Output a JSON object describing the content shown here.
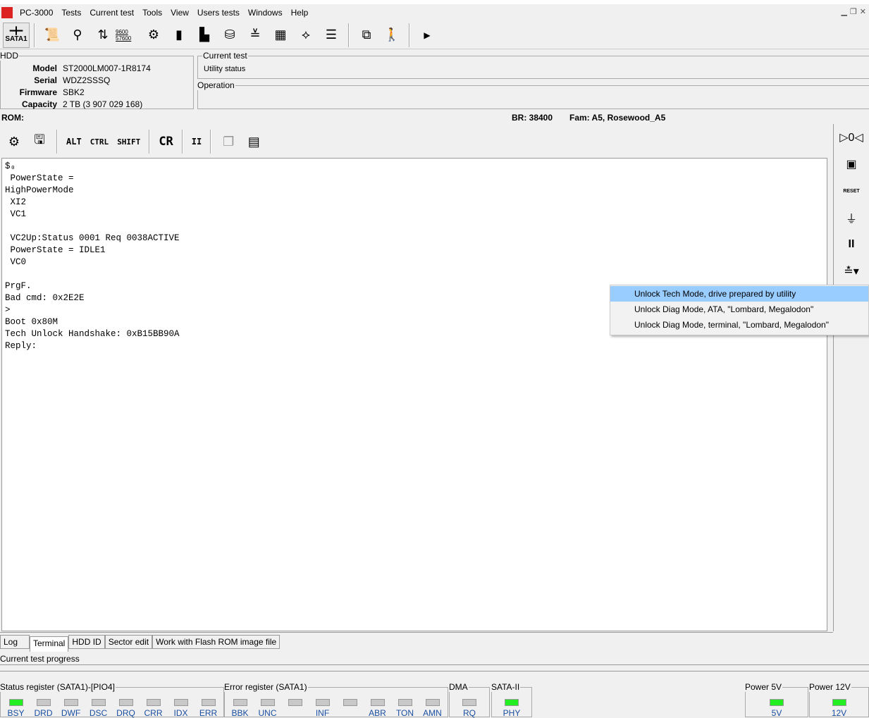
{
  "app": {
    "title": "PC-3000",
    "logo": "PC"
  },
  "menu": [
    "Tests",
    "Current test",
    "Tools",
    "View",
    "Users tests",
    "Windows",
    "Help"
  ],
  "toolbar": {
    "port_label": "SATA1",
    "icons": [
      "info-scroll-icon",
      "bulb-icon",
      "transfer-icon",
      "baud-rate-icon",
      "settings-disk-icon",
      "chip-icon",
      "board-icon",
      "disk-check-icon",
      "layers-icon",
      "grid-icon",
      "flowchart-icon",
      "list-icon",
      "windows-icon",
      "exit-icon",
      "more-icon"
    ],
    "baud_text": "9600 57600"
  },
  "hdd": {
    "legend": "HDD",
    "fields": [
      {
        "k": "Model",
        "v": "ST2000LM007-1R8174"
      },
      {
        "k": "Serial",
        "v": "WDZ2SSSQ"
      },
      {
        "k": "Firmware",
        "v": "SBK2"
      },
      {
        "k": "Capacity",
        "v": "2 TB (3 907 029 168)"
      }
    ]
  },
  "current_test": {
    "legend": "Current test",
    "status": "Utility status"
  },
  "operation": {
    "legend": "Operation"
  },
  "rom": {
    "label": "ROM:",
    "br": "BR: 38400",
    "fam": "Fam: A5, Rosewood_A5"
  },
  "terminal_toolbar": {
    "alt": "ALT",
    "ctrl": "CTRL",
    "shift": "SHIFT",
    "cr": "CR",
    "pause": "II"
  },
  "terminal_text": "$₀\n PowerState =\nHighPowerMode\n XI2\n VC1\n\n VC2Up:Status 0001 Req 0038ACTIVE\n PowerState = IDLE1\n VC0\n\nPrgF.\nBad cmd: 0x2E2E\n>\nBoot 0x80M\nTech Unlock Handshake: 0xB15BB90A\nReply:",
  "right_panel": {
    "pause": "II",
    "reset": "RESET"
  },
  "context_menu": [
    "Unlock Tech Mode, drive prepared by utility",
    "Unlock Diag Mode, ATA, \"Lombard, Megalodon\"",
    "Unlock Diag Mode, terminal, \"Lombard, Megalodon\""
  ],
  "tabs": [
    "Log",
    "Terminal",
    "HDD ID",
    "Sector edit",
    "Work with Flash ROM image file"
  ],
  "progress": {
    "label": "Current test progress",
    "value": 0
  },
  "status_register": {
    "legend": "Status register (SATA1)-[PIO4]",
    "bits": [
      {
        "n": "BSY",
        "on": true
      },
      {
        "n": "DRD",
        "on": false
      },
      {
        "n": "DWF",
        "on": false
      },
      {
        "n": "DSC",
        "on": false
      },
      {
        "n": "DRQ",
        "on": false
      },
      {
        "n": "CRR",
        "on": false
      },
      {
        "n": "IDX",
        "on": false
      },
      {
        "n": "ERR",
        "on": false
      }
    ]
  },
  "error_register": {
    "legend": "Error register (SATA1)",
    "bits": [
      {
        "n": "BBK",
        "on": false
      },
      {
        "n": "UNC",
        "on": false
      },
      {
        "n": "",
        "on": false
      },
      {
        "n": "INF",
        "on": false
      },
      {
        "n": "",
        "on": false
      },
      {
        "n": "ABR",
        "on": false
      },
      {
        "n": "TON",
        "on": false
      },
      {
        "n": "AMN",
        "on": false
      }
    ]
  },
  "dma": {
    "legend": "DMA",
    "bits": [
      {
        "n": "RQ",
        "on": false
      }
    ]
  },
  "sata2": {
    "legend": "SATA-II",
    "bits": [
      {
        "n": "PHY",
        "on": true
      }
    ]
  },
  "power5": {
    "legend": "Power 5V",
    "bits": [
      {
        "n": "5V",
        "on": true
      }
    ]
  },
  "power12": {
    "legend": "Power 12V",
    "bits": [
      {
        "n": "12V",
        "on": true
      }
    ]
  }
}
